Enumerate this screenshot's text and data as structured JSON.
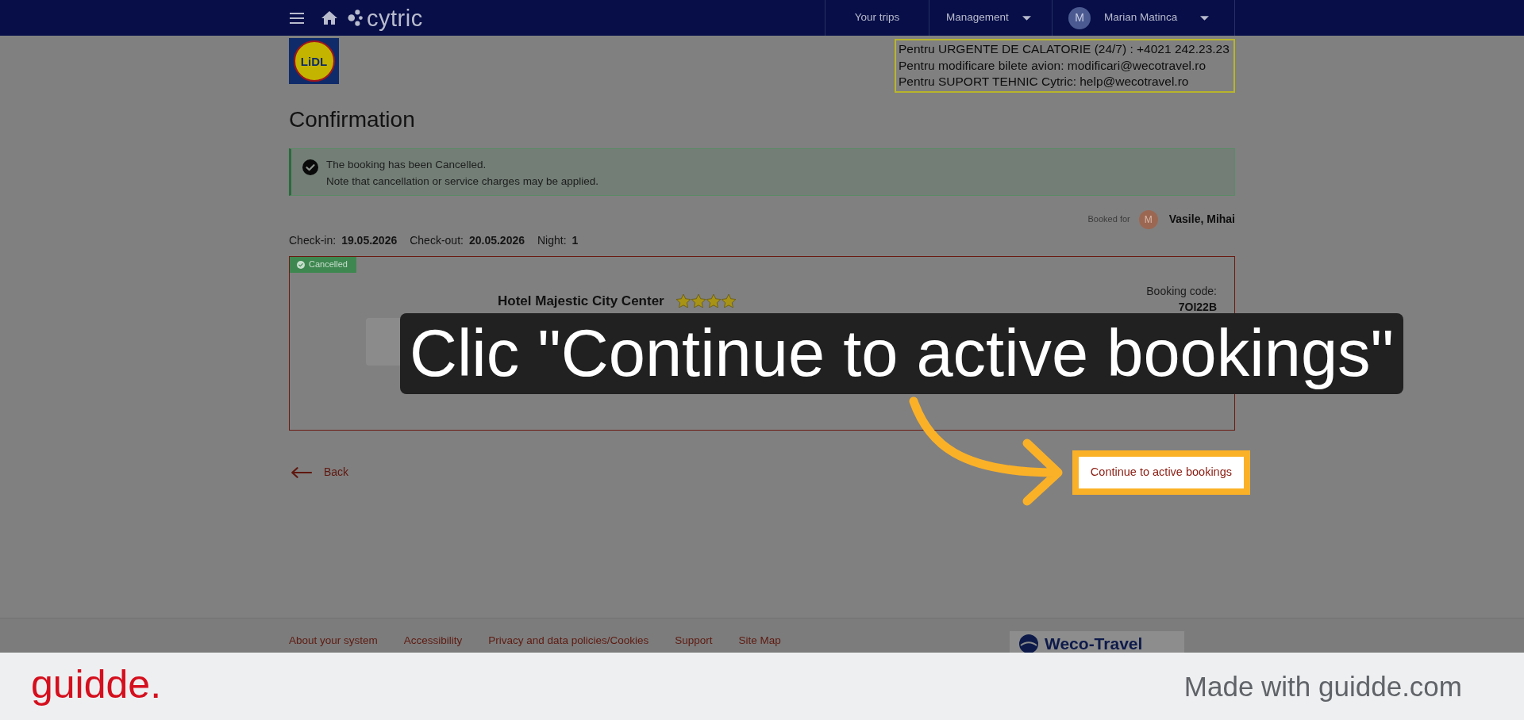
{
  "nav": {
    "brand": "cytric",
    "items": [
      {
        "label": "Your trips",
        "dropdown": false
      },
      {
        "label": "Management",
        "dropdown": true
      }
    ],
    "user": {
      "initial": "M",
      "name": "Marian Matinca"
    }
  },
  "header": {
    "logo_text": "LiDL",
    "contacts": [
      "Pentru URGENTE DE CALATORIE (24/7) : +4021 242.23.23",
      "Pentru modificare bilete avion: modificari@wecotravel.ro",
      "Pentru SUPORT TEHNIC Cytric: help@wecotravel.ro"
    ]
  },
  "page_title": "Confirmation",
  "alert": {
    "lines": [
      "The booking has been Cancelled.",
      "Note that cancellation or service charges may be applied."
    ]
  },
  "booked_for": {
    "label": "Booked for",
    "initial": "M",
    "name": "Vasile, Mihai"
  },
  "stay": [
    {
      "label": "Check-in:",
      "value": "19.05.2026"
    },
    {
      "label": "Check-out:",
      "value": "20.05.2026"
    },
    {
      "label": "Night:",
      "value": "1"
    }
  ],
  "booking": {
    "status": "Cancelled",
    "hotel_name": "Hotel Majestic City Center",
    "stars": 4,
    "code_label": "Booking code:",
    "code": "7OI22B"
  },
  "actions": {
    "back": "Back",
    "continue": {
      "label": "Continue to active bookings",
      "highlighted": true
    }
  },
  "callout": "Clic \"Continue to active bookings\"",
  "footer": {
    "links": [
      "About your system",
      "Accessibility",
      "Privacy and data policies/Cookies",
      "Support",
      "Site Map"
    ],
    "partner_logo": "Weco-Travel"
  },
  "banner": {
    "brand": "guidde.",
    "text": "Made with guidde.com"
  }
}
